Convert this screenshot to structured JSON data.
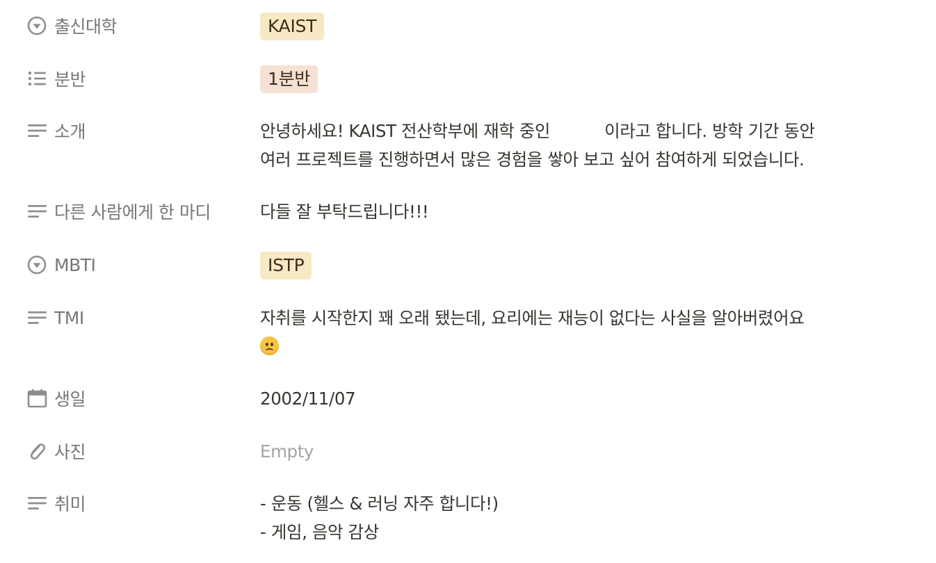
{
  "properties": [
    {
      "label": "출신대학",
      "icon": "select-icon",
      "value": "KAIST"
    },
    {
      "label": "분반",
      "icon": "multi-select-list-icon",
      "value": "1분반"
    },
    {
      "label": "소개",
      "icon": "text-lines-icon",
      "lines": [
        "안녕하세요! KAIST 전산학부에 재학 중인",
        "이라고 합니다. 방학 기간 동안",
        "여러 프로젝트를 진행하면서 많은 경험을 쌓아 보고 싶어 참여하게 되었습니다."
      ]
    },
    {
      "label": "다른 사람에게 한 마디",
      "icon": "text-lines-icon",
      "value": "다들 잘 부탁드립니다!!!"
    },
    {
      "label": "MBTI",
      "icon": "select-icon",
      "value": "ISTP"
    },
    {
      "label": "TMI",
      "icon": "text-lines-icon",
      "lines": [
        "자취를 시작한지 꽤 오래 됐는데, 요리에는 재능이 없다는 사실을 알아버렸어요"
      ],
      "emoji": "worried-face-emoji"
    },
    {
      "label": "생일",
      "icon": "calendar-icon",
      "value": "2002/11/07"
    },
    {
      "label": "사진",
      "icon": "paperclip-icon",
      "value": "Empty"
    },
    {
      "label": "취미",
      "icon": "text-lines-icon",
      "lines": [
        "- 운동 (헬스 & 러닝 자주 합니다!)",
        "- 게임, 음악 감상"
      ]
    }
  ],
  "colors": {
    "label": "#787774",
    "text": "#37352f",
    "empty": "#a6a5a1",
    "tag_yellow": "#f7e9c4",
    "tag_orange": "#f6e1d5"
  }
}
